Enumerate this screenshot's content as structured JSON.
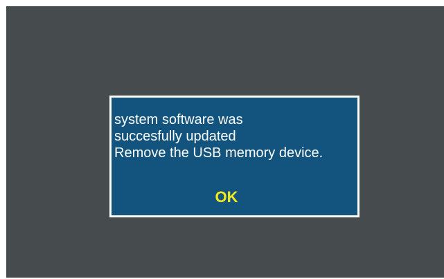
{
  "dialog": {
    "message_lines": [
      "system software was",
      "succesfully updated",
      "Remove the USB memory device."
    ],
    "ok_label": "OK"
  },
  "colors": {
    "screen_background": "#464c4d",
    "dialog_background": "#12547e",
    "dialog_border": "#ffffff",
    "message_text": "#ffffff",
    "ok_text": "#f3e921"
  }
}
